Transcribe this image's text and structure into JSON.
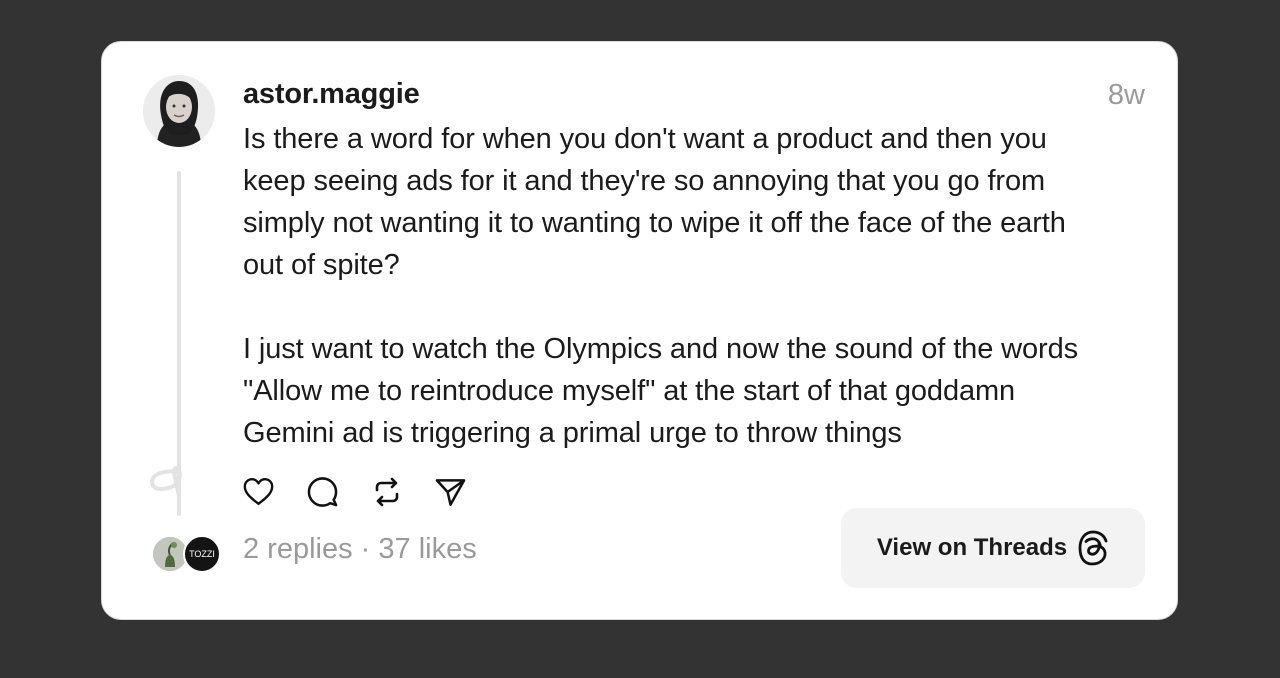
{
  "post": {
    "username": "astor.maggie",
    "timestamp": "8w",
    "text": "Is there a word for when you don't want a product and then you\nkeep seeing ads for it and they're so annoying that you go from\nsimply not wanting it to wanting to wipe it off the face of the earth\nout of spite?\n\nI just want to watch the Olympics and now the sound of the words\n\"Allow me to reintroduce myself\" at the start of that goddamn\nGemini ad is triggering a primal urge to throw things",
    "stats": "2 replies · 37 likes",
    "reply_avatar_2_text": "TOZZI"
  },
  "actions": {
    "like_icon": "heart-icon",
    "reply_icon": "comment-icon",
    "repost_icon": "repost-icon",
    "share_icon": "send-icon"
  },
  "view_button": {
    "label": "View on Threads",
    "icon": "threads-logo-icon"
  },
  "colors": {
    "background": "#333333",
    "card": "#ffffff",
    "text": "#1b1b1b",
    "muted": "#9a9a9a",
    "button_bg": "#f3f3f3"
  }
}
